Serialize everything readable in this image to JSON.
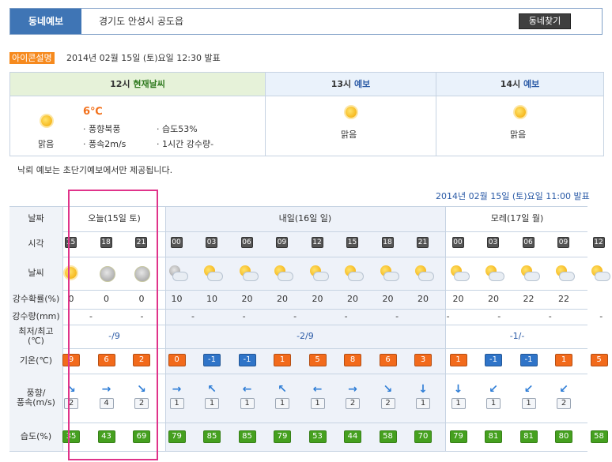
{
  "header": {
    "label": "동네예보",
    "location": "경기도 안성시 공도읍",
    "find_button": "동네찾기"
  },
  "icon_help_label": "아이콘설명",
  "observed": "2014년 02월 15일 (토)요일 12:30 발표",
  "current": {
    "header_time": "12시",
    "header_title": "현재날씨",
    "temp": "6℃",
    "condition": "맑음",
    "wind_dir": "풍향북풍",
    "wind_speed": "풍속2m/s",
    "humidity": "습도53%",
    "rain_1h": "1시간 강수량-"
  },
  "forecast_13": {
    "time": "13시",
    "title": "예보",
    "condition": "맑음"
  },
  "forecast_14": {
    "time": "14시",
    "title": "예보",
    "condition": "맑음"
  },
  "notice": "낙뢰 예보는 초단기예보에서만 제공됩니다.",
  "forecast_time": "2014년 02월 15일 (토)요일 11:00 발표",
  "grid": {
    "labels": {
      "date": "날짜",
      "time": "시각",
      "weather": "날씨",
      "rain_prob": "강수확률(%)",
      "rain_amt": "강수량(mm)",
      "minmax": "최저/최고\n(℃)",
      "temp": "기온(℃)",
      "wind": "풍향/\n풍속(m/s)",
      "humidity": "습도(%)"
    },
    "days": [
      {
        "label": "오늘(15일 토)",
        "minmax": "-/9",
        "rain_amt": "-"
      },
      {
        "label": "내일(16일 일)",
        "minmax": "-2/9",
        "rain_amt": "-"
      },
      {
        "label": "모레(17일 월)",
        "minmax": "-1/-",
        "rain_amt": "-"
      }
    ],
    "hours": [
      "15",
      "18",
      "21",
      "00",
      "03",
      "06",
      "09",
      "12",
      "15",
      "18",
      "21",
      "00",
      "03",
      "06",
      "09",
      "12"
    ],
    "weather_icons": [
      "sun",
      "moon",
      "moon",
      "mooncloud",
      "cloud",
      "cloud",
      "cloud",
      "cloud",
      "cloud",
      "cloud",
      "cloud",
      "cloud",
      "cloud",
      "cloud",
      "cloud",
      "cloud"
    ],
    "rain_prob": [
      "0",
      "0",
      "0",
      "10",
      "10",
      "20",
      "20",
      "20",
      "20",
      "20",
      "20",
      "20",
      "20",
      "22",
      "22"
    ],
    "rain_amt_cells": [
      "-",
      "-",
      "-",
      "-",
      "-",
      "-",
      "-",
      "-",
      "-",
      "-",
      "-"
    ],
    "temps": [
      "9",
      "6",
      "2",
      "0",
      "-1",
      "-1",
      "1",
      "5",
      "8",
      "6",
      "3",
      "1",
      "-1",
      "-1",
      "1",
      "5"
    ],
    "winds": [
      "2",
      "4",
      "2",
      "1",
      "1",
      "1",
      "1",
      "1",
      "2",
      "2",
      "1",
      "1",
      "1",
      "1",
      "2"
    ],
    "wind_dirs": [
      "↘",
      "→",
      "↘",
      "→",
      "↖",
      "←",
      "↖",
      "←",
      "→",
      "↘",
      "↓",
      "↓",
      "↙",
      "↙",
      "↙",
      "↙"
    ],
    "humidity": [
      "35",
      "43",
      "69",
      "79",
      "85",
      "85",
      "79",
      "53",
      "44",
      "58",
      "70",
      "79",
      "81",
      "81",
      "80",
      "58"
    ],
    "colors": {
      "warm": "#f26a1b",
      "cold": "#2f74c8",
      "humid": "#45a01f",
      "highlight": "#e0338a"
    }
  }
}
